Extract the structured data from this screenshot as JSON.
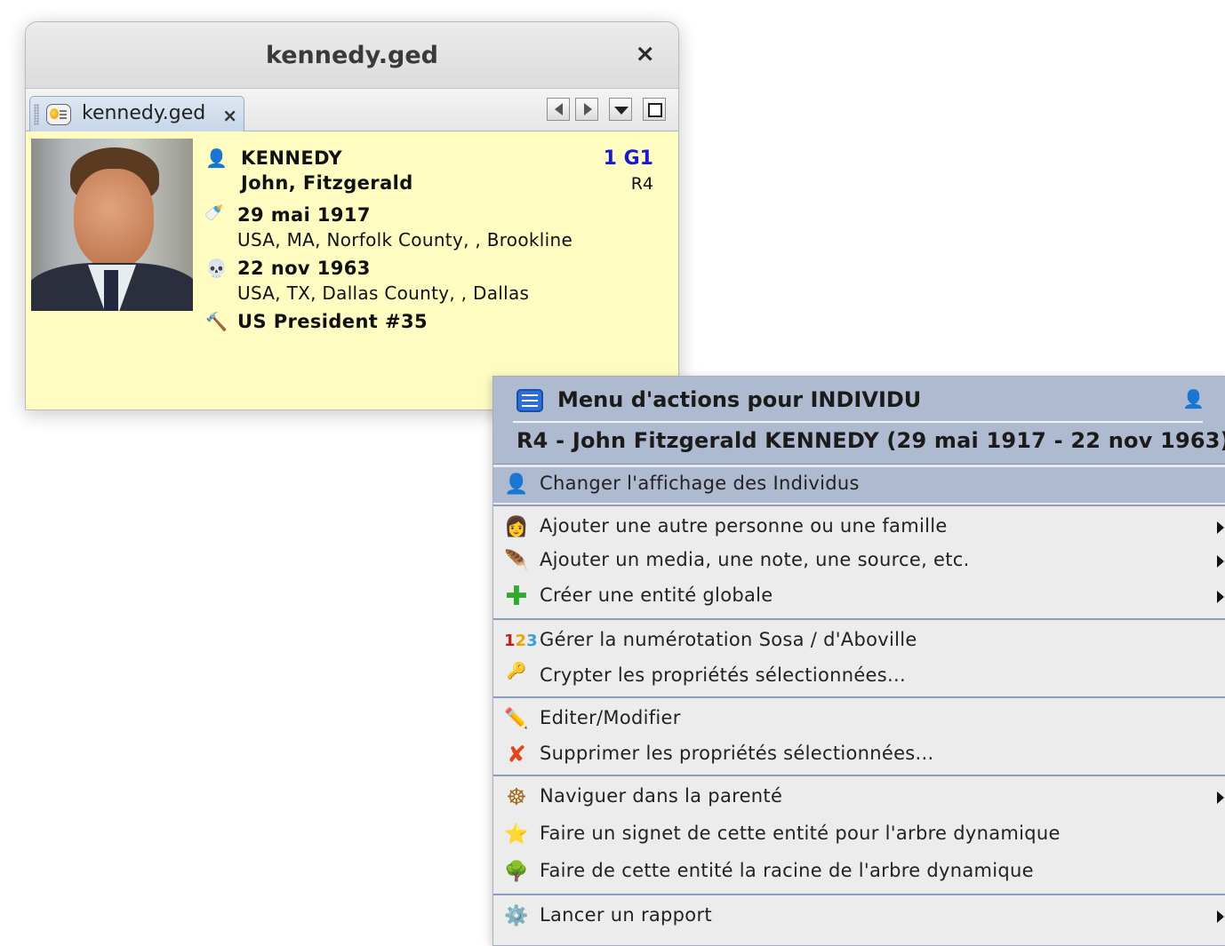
{
  "window": {
    "title": "kennedy.ged",
    "close_label": "×",
    "tab": {
      "label": "kennedy.ged",
      "close_label": "×"
    }
  },
  "person": {
    "surname": "KENNEDY",
    "given_names": "John, Fitzgerald",
    "sosa": "1 G1",
    "ref": "R4",
    "birth_date": "29 mai 1917",
    "birth_place": "USA, MA, Norfolk County, , Brookline",
    "death_date": "22 nov 1963",
    "death_place": "USA, TX, Dallas County, , Dallas",
    "occupation": "US President #35"
  },
  "menu": {
    "title": "Menu d'actions pour INDIVIDU",
    "subtitle": "R4 - John Fitzgerald KENNEDY (29 mai 1917 - 22 nov 1963)",
    "items": [
      {
        "label": "Changer l'affichage des Individus",
        "icon": "person-icon",
        "submenu": false,
        "highlighted": true
      },
      {
        "label": "Ajouter une autre personne ou une famille",
        "icon": "add-person-icon",
        "submenu": true
      },
      {
        "label": "Ajouter un media, une note, une source, etc.",
        "icon": "feather-icon",
        "submenu": true
      },
      {
        "label": "Créer une entité globale",
        "icon": "green-plus-icon",
        "submenu": true
      },
      {
        "label": "Gérer la numérotation Sosa / d'Aboville",
        "icon": "numbers-icon",
        "submenu": false
      },
      {
        "label": "Crypter les propriétés sélectionnées...",
        "icon": "key-icon",
        "submenu": false
      },
      {
        "label": "Editer/Modifier",
        "icon": "pencil-icon",
        "submenu": false
      },
      {
        "label": "Supprimer les propriétés sélectionnées...",
        "icon": "delete-icon",
        "submenu": false
      },
      {
        "label": "Naviguer dans la parenté",
        "icon": "ship-wheel-icon",
        "submenu": true
      },
      {
        "label": "Faire un signet de cette entité pour l'arbre dynamique",
        "icon": "star-icon",
        "submenu": false
      },
      {
        "label": "Faire de cette entité la racine de l'arbre dynamique",
        "icon": "tree-icon",
        "submenu": false
      },
      {
        "label": "Lancer un rapport",
        "icon": "report-icon",
        "submenu": true
      }
    ]
  },
  "colors": {
    "content_bg": "#fffcc2",
    "menu_header_bg": "#aebad0",
    "menu_bg": "#ececec",
    "sosa_text": "#1a1acc"
  }
}
